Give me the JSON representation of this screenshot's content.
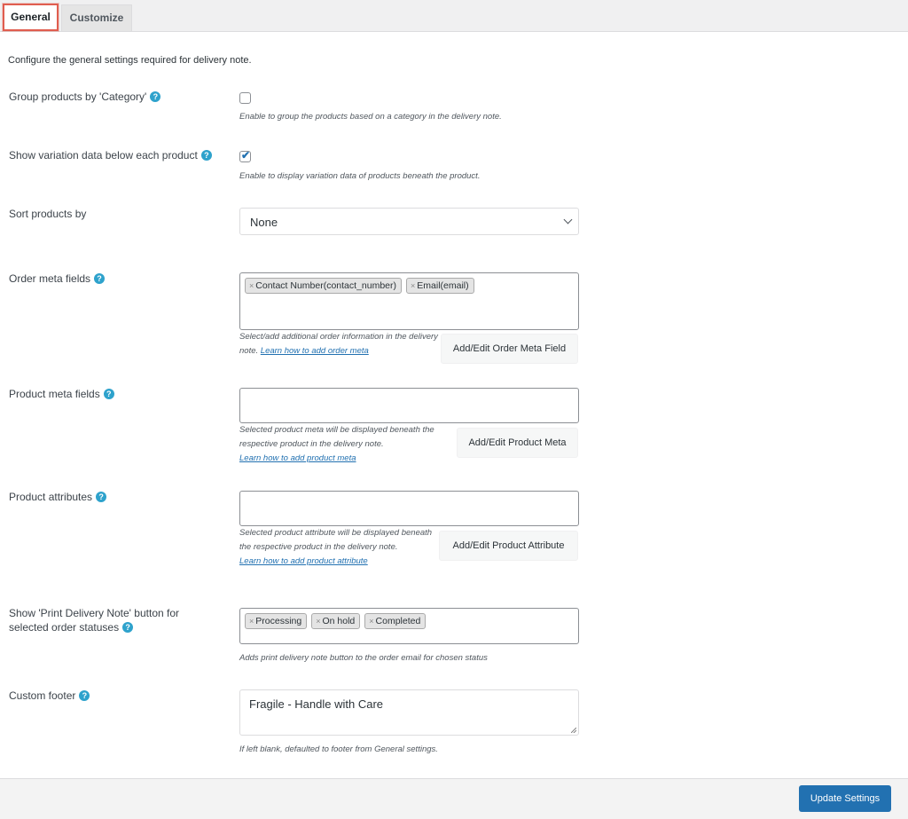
{
  "tabs": [
    {
      "label": "General",
      "active": true
    },
    {
      "label": "Customize",
      "active": false
    }
  ],
  "intro": "Configure the general settings required for delivery note.",
  "help_glyph": "?",
  "settings": {
    "group_by_category": {
      "label": "Group products by 'Category'",
      "checked": false,
      "description": "Enable to group the products based on a category in the delivery note."
    },
    "show_variation": {
      "label": "Show variation data below each product",
      "checked": true,
      "check_glyph": "✔",
      "description": "Enable to display variation data of products beneath the product."
    },
    "sort_products": {
      "label": "Sort products by",
      "value": "None"
    },
    "order_meta": {
      "label": "Order meta fields",
      "chips": [
        "Contact Number(contact_number)",
        "Email(email)"
      ],
      "description": "Select/add additional order information in the delivery note.",
      "link": "Learn how to add order meta",
      "button": "Add/Edit Order Meta Field"
    },
    "product_meta": {
      "label": "Product meta fields",
      "description": "Selected product meta will be displayed beneath the respective product in the delivery note.",
      "link": "Learn how to add product meta",
      "button": "Add/Edit Product Meta"
    },
    "product_attributes": {
      "label": "Product attributes",
      "description": "Selected product attribute will be displayed beneath the respective product in the delivery note.",
      "link": "Learn how to add product attribute",
      "button": "Add/Edit Product Attribute"
    },
    "print_button_statuses": {
      "label": "Show 'Print Delivery Note' button for selected order statuses",
      "chips": [
        "Processing",
        "On hold",
        "Completed"
      ],
      "description": "Adds print delivery note button to the order email for chosen status"
    },
    "custom_footer": {
      "label": "Custom footer",
      "value": "Fragile - Handle with Care",
      "description": "If left blank, defaulted to footer from General settings."
    }
  },
  "chip_remove_glyph": "×",
  "update_button": "Update Settings",
  "colors": {
    "primary": "#2271b1",
    "help": "#2ea2cc",
    "active_tab_outline": "#e05d4f"
  }
}
